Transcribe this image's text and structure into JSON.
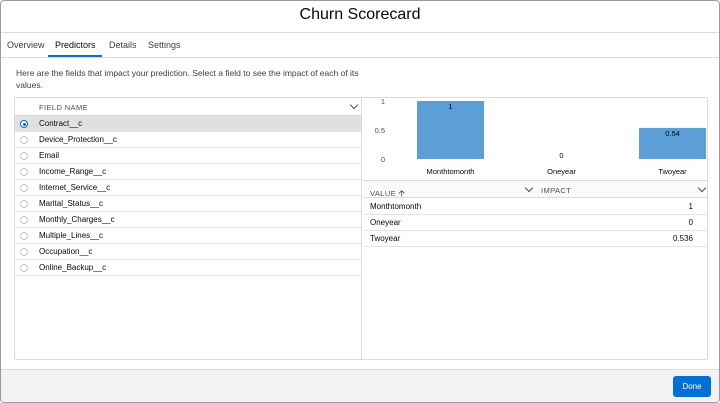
{
  "modal": {
    "title": "Churn Scorecard"
  },
  "tabs": [
    {
      "label": "Overview"
    },
    {
      "label": "Predictors"
    },
    {
      "label": "Details"
    },
    {
      "label": "Settings"
    }
  ],
  "description": "Here are the fields that impact your prediction. Select a field to see the impact of each of its values.",
  "fields_list": {
    "header": "FIELD NAME",
    "items": [
      {
        "label": "Contract__c",
        "selected": true
      },
      {
        "label": "Device_Protection__c",
        "selected": false
      },
      {
        "label": "Email",
        "selected": false
      },
      {
        "label": "Income_Range__c",
        "selected": false
      },
      {
        "label": "Internet_Service__c",
        "selected": false
      },
      {
        "label": "Marital_Status__c",
        "selected": false
      },
      {
        "label": "Monthly_Charges__c",
        "selected": false
      },
      {
        "label": "Multiple_Lines__c",
        "selected": false
      },
      {
        "label": "Occupation__c",
        "selected": false
      },
      {
        "label": "Online_Backup__c",
        "selected": false
      }
    ]
  },
  "chart_data": {
    "type": "bar",
    "categories": [
      "Monthtomonth",
      "Oneyear",
      "Twoyear"
    ],
    "values": [
      1,
      0,
      0.536
    ],
    "data_labels": [
      "1",
      "0",
      "0.54"
    ],
    "yticks": [
      "1",
      "0.5",
      "0"
    ],
    "ylim": [
      0,
      1
    ],
    "bar_color": "#5b9fd6",
    "grid": false
  },
  "impact_table": {
    "col_value": "VALUE",
    "col_impact": "IMPACT",
    "sort_icon": "arrow-up-icon",
    "rows": [
      {
        "value": "Monthtomonth",
        "impact": "1"
      },
      {
        "value": "Oneyear",
        "impact": "0"
      },
      {
        "value": "Twoyear",
        "impact": "0.536"
      }
    ]
  },
  "footer": {
    "done_label": "Done"
  },
  "colors": {
    "accent": "#0070d2",
    "selected_row": "#e0e0e0",
    "footer_bg": "#f3f2f2"
  }
}
